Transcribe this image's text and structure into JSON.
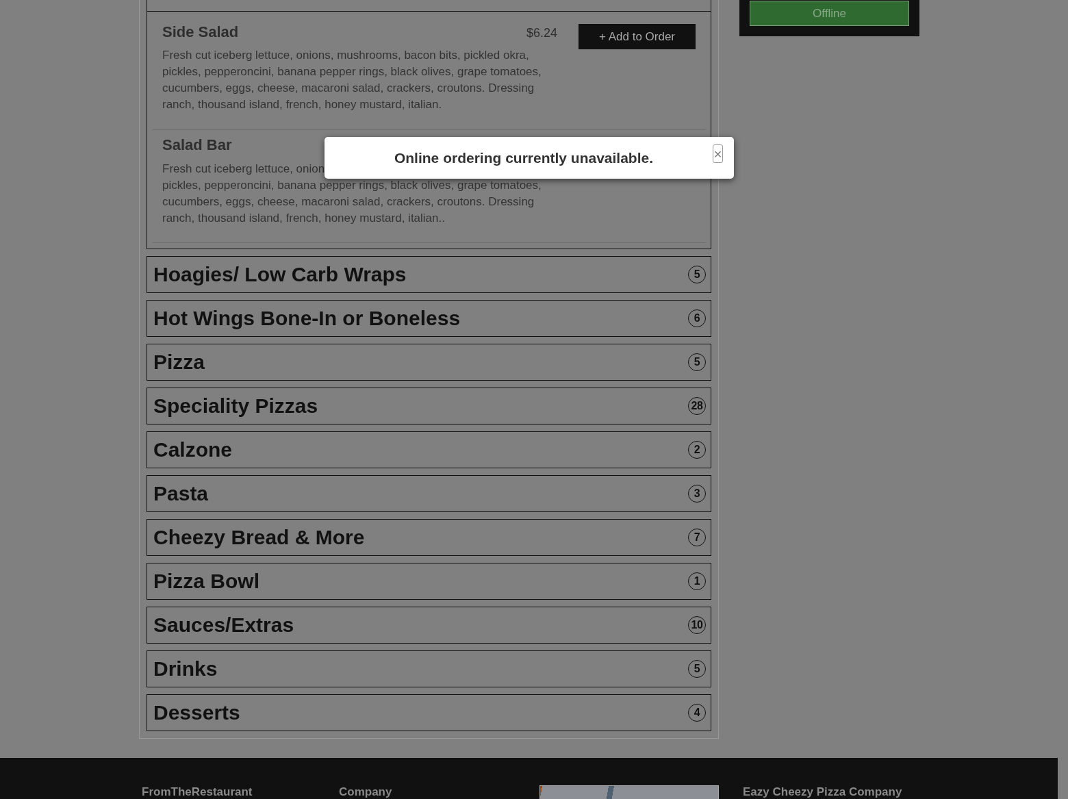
{
  "menu": {
    "categories": [
      {
        "expanded": true,
        "items": [
          {
            "name": "Side Salad",
            "price": "$6.24",
            "description": "Fresh cut iceberg lettuce, onions, mushrooms, bacon bits, pickled okra, pickles, pepperoncini, banana pepper rings, black olives, grape tomatoes, cucumbers, eggs, cheese, macaroni salad, crackers, croutons. Dressing ranch, thousand island, french, honey mustard, italian.",
            "button": "+ Add to Order"
          },
          {
            "name": "Salad Bar",
            "description_lines": [
              "Fresh cut iceberg lettuce, onion",
              "pickles, pepperoncini, banana pepper rings, black olives, grape tomatoes,",
              "cucumbers, eggs, cheese, macaroni salad, crackers, croutons. Dressing",
              "ranch, thousand island, french, honey mustard, italian.."
            ]
          }
        ]
      },
      {
        "title": "Hoagies/ Low Carb Wraps",
        "count": "5",
        "expanded": false
      },
      {
        "title": "Hot Wings Bone-In or Boneless",
        "count": "6",
        "expanded": false
      },
      {
        "title": "Pizza",
        "count": "5",
        "expanded": false
      },
      {
        "title": "Speciality Pizzas",
        "count": "28",
        "expanded": false
      },
      {
        "title": "Calzone",
        "count": "2",
        "expanded": false
      },
      {
        "title": "Pasta",
        "count": "3",
        "expanded": false
      },
      {
        "title": "Cheezy Bread & More",
        "count": "7",
        "expanded": false
      },
      {
        "title": "Pizza Bowl",
        "count": "1",
        "expanded": false
      },
      {
        "title": "Sauces/Extras",
        "count": "10",
        "expanded": false
      },
      {
        "title": "Drinks",
        "count": "5",
        "expanded": false
      },
      {
        "title": "Desserts",
        "count": "4",
        "expanded": false
      }
    ]
  },
  "status_panel": {
    "button": "Offline"
  },
  "footer": {
    "columns": [
      {
        "kind": "heading",
        "title": "FromTheRestaurant"
      },
      {
        "kind": "heading",
        "title": "Company"
      },
      {
        "kind": "map"
      },
      {
        "kind": "heading",
        "title": "Eazy Cheezy Pizza Company"
      }
    ]
  },
  "modal": {
    "message": "Online ordering currently unavailable.",
    "close": "×"
  }
}
